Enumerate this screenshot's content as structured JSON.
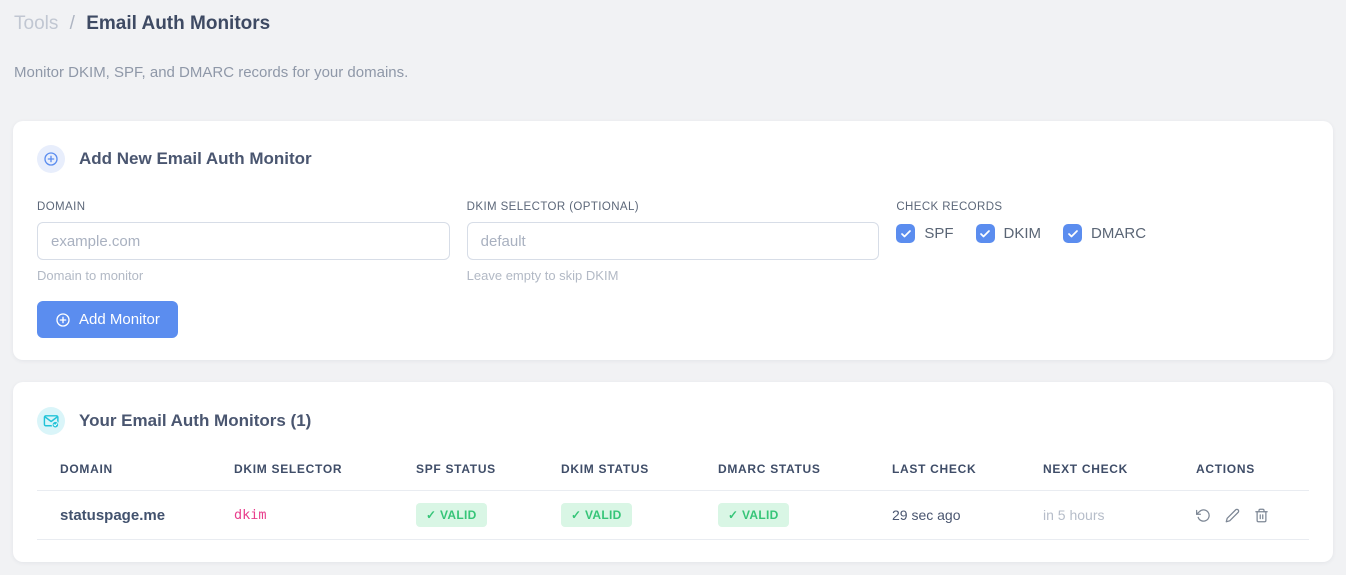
{
  "page": {
    "breadcrumb": {
      "section": "Tools",
      "separator": "/",
      "current": "Email Auth Monitors"
    },
    "subtitle": "Monitor DKIM, SPF, and DMARC records for your domains."
  },
  "add_monitor_card": {
    "title": "Add New Email Auth Monitor",
    "fields": {
      "domain": {
        "label": "DOMAIN",
        "value": "",
        "placeholder": "example.com",
        "helper": "Domain to monitor"
      },
      "dkim_selector": {
        "label": "DKIM SELECTOR (OPTIONAL)",
        "value": "",
        "placeholder": "default",
        "helper": "Leave empty to skip DKIM"
      }
    },
    "check_records": {
      "label": "CHECK RECORDS",
      "options": [
        {
          "label": "SPF",
          "checked": true
        },
        {
          "label": "DKIM",
          "checked": true
        },
        {
          "label": "DMARC",
          "checked": true
        }
      ]
    },
    "submit_label": "Add Monitor"
  },
  "monitors_card": {
    "title": "Your Email Auth Monitors (1)",
    "count": 1,
    "table": {
      "headers": [
        "DOMAIN",
        "DKIM SELECTOR",
        "SPF STATUS",
        "DKIM STATUS",
        "DMARC STATUS",
        "LAST CHECK",
        "NEXT CHECK",
        "ACTIONS"
      ],
      "rows": [
        {
          "domain": "statuspage.me",
          "dkim_selector": "dkim",
          "spf_status": "VALID",
          "dkim_status": "VALID",
          "dmarc_status": "VALID",
          "last_check": "29 sec ago",
          "next_check": "in 5 hours"
        }
      ]
    }
  },
  "icons": {
    "check_glyph": "✓",
    "add_card_icon": "plus-circle-icon",
    "list_card_icon": "envelope-check-icon",
    "row_actions": [
      "refresh-icon",
      "edit-pencil-icon",
      "trash-icon"
    ]
  },
  "colors": {
    "page_background": "#f1f2f4",
    "accent_blue": "#5b8def",
    "accent_blue_bg": "#e8eefc",
    "teal": "#22c3d8",
    "teal_bg": "#daf5f9",
    "success_text": "#36c578",
    "success_bg": "#d9f6e5",
    "code_pink": "#e83e8c",
    "muted_gray": "#b6bdc9",
    "heading_navy": "#3e4a63"
  }
}
